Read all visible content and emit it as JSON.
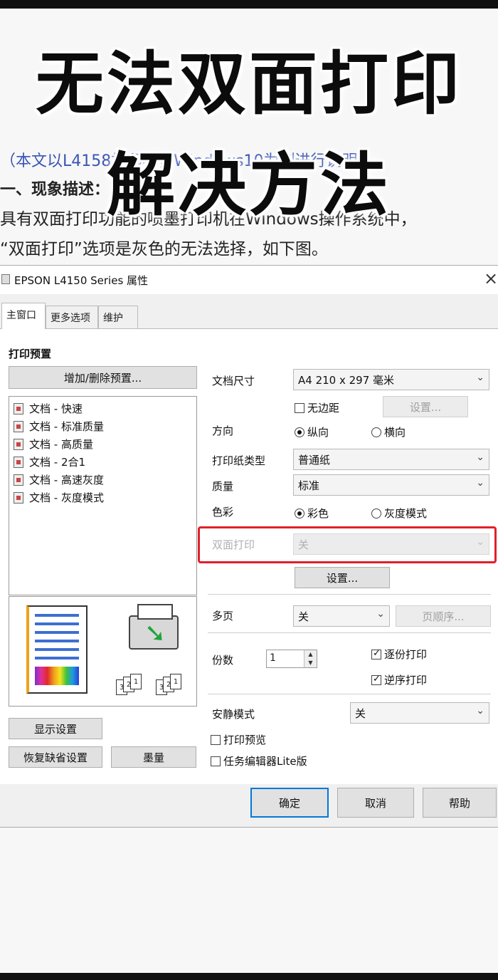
{
  "headline": {
    "line1": "无法双面打印",
    "line2": "解决方法"
  },
  "article": {
    "note": "（本文以L4158打印机，Windows10为例进行说明）",
    "section_head": "一、现象描述：",
    "body_line1": "具有双面打印功能的喷墨打印机在Windows操作系统中，",
    "body_line2": "“双面打印”选项是灰色的无法选择，如下图。"
  },
  "dialog": {
    "title": "EPSON L4150 Series 属性",
    "close": "×",
    "tabs": [
      "主窗口",
      "更多选项",
      "维护"
    ],
    "presets_title": "打印预置",
    "add_remove_preset": "增加/删除预置...",
    "presets": [
      "文档 - 快速",
      "文档 - 标准质量",
      "文档 - 高质量",
      "文档 - 2合1",
      "文档 - 高速灰度",
      "文档 - 灰度模式"
    ],
    "show_settings": "显示设置",
    "restore_defaults": "恢复缺省设置",
    "ink_levels": "墨量",
    "paper_size_label": "文档尺寸",
    "paper_size_value": "A4 210 x 297 毫米",
    "borderless_label": "无边距",
    "borderless_checked": false,
    "borderless_settings": "设置...",
    "orientation_label": "方向",
    "orientation_portrait": "纵向",
    "orientation_landscape": "横向",
    "paper_type_label": "打印纸类型",
    "paper_type_value": "普通纸",
    "quality_label": "质量",
    "quality_value": "标准",
    "color_label": "色彩",
    "color_option": "彩色",
    "grayscale_option": "灰度模式",
    "duplex_label": "双面打印",
    "duplex_value": "关",
    "duplex_settings": "设置...",
    "multipage_label": "多页",
    "multipage_value": "关",
    "page_order": "页顺序...",
    "copies_label": "份数",
    "copies_value": "1",
    "collate_label": "逐份打印",
    "reverse_label": "逆序打印",
    "collate_checked": true,
    "reverse_checked": true,
    "quiet_mode_label": "安静模式",
    "quiet_mode_value": "关",
    "print_preview_label": "打印预览",
    "job_arranger_label": "任务编辑器Lite版",
    "ok": "确定",
    "cancel": "取消",
    "help": "帮助",
    "highlight_color": "#e0202a",
    "link_color": "#3a55b4"
  }
}
